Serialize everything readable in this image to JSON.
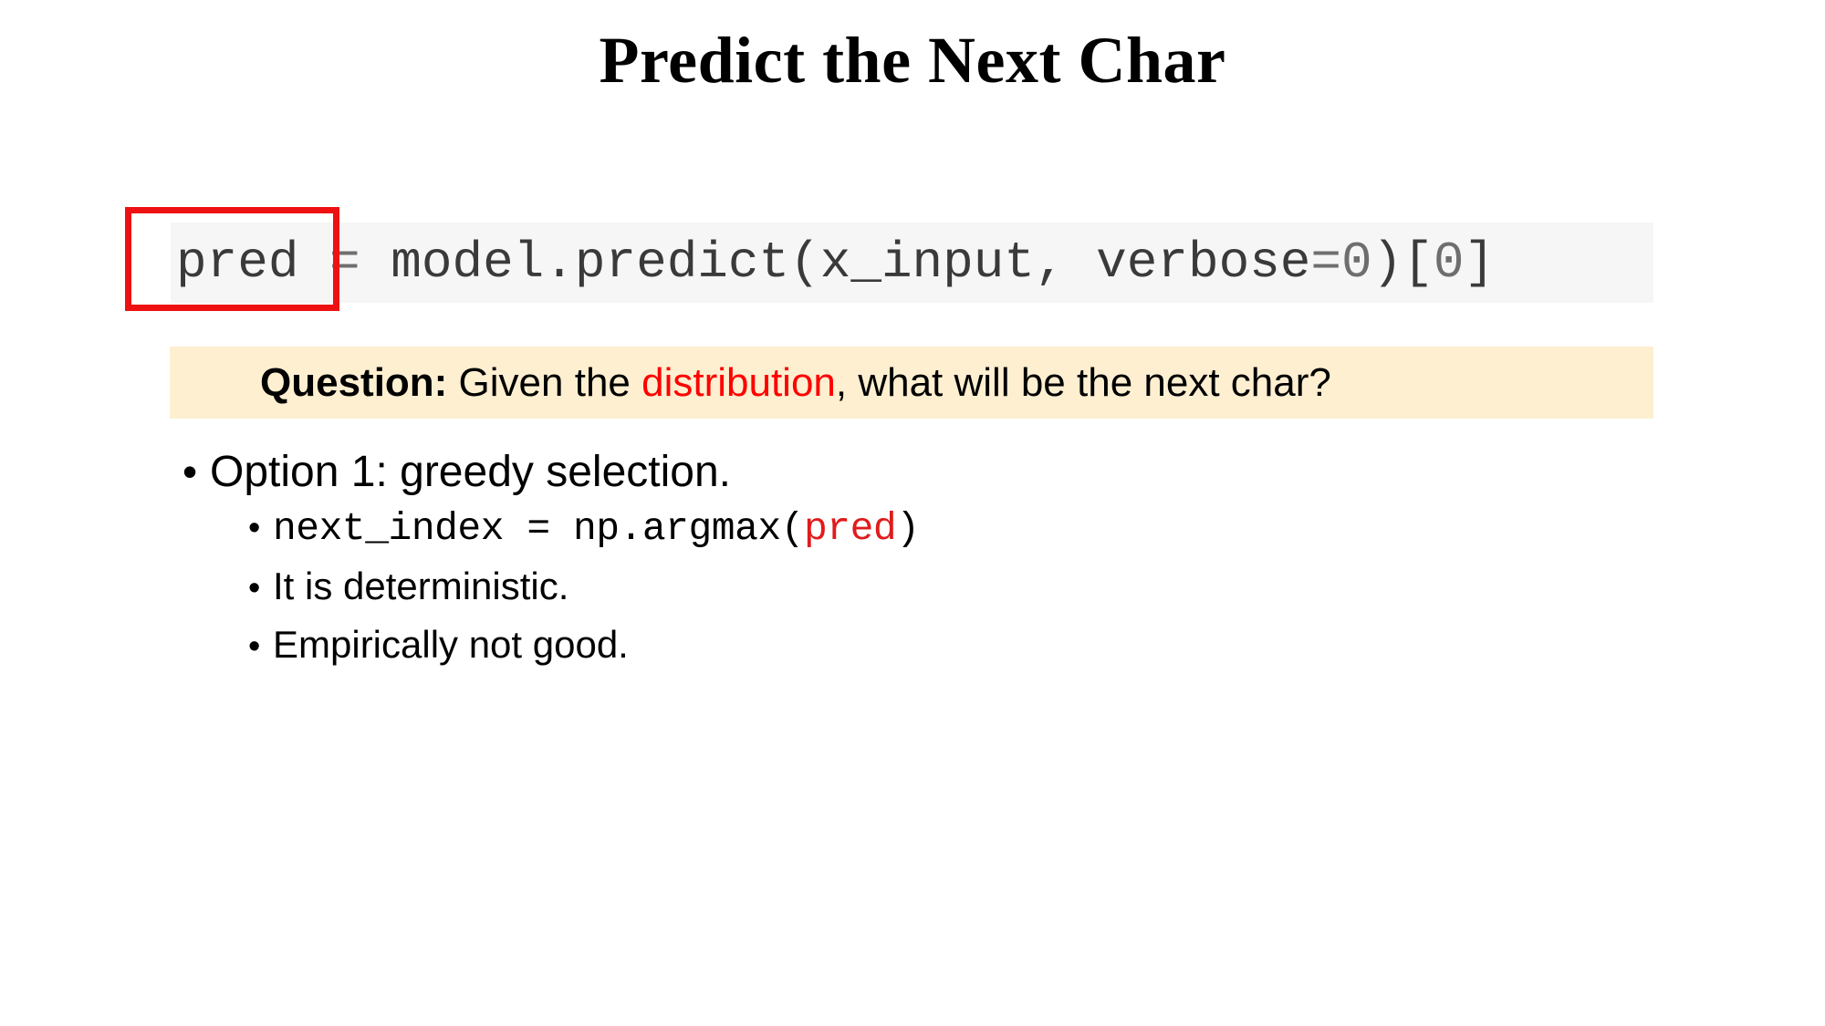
{
  "slide": {
    "title": "Predict the Next Char"
  },
  "code_block": {
    "highlight_label": "pred",
    "segments": {
      "var": "pred",
      "assign": " = ",
      "call": "model.predict(x_input, verbose",
      "eq2": "=",
      "zero1": "0",
      "close": ")[",
      "zero2": "0",
      "bracket": "]"
    },
    "full_text": "pred = model.predict(x_input, verbose=0)[0]"
  },
  "question_banner": {
    "label": "Question:",
    "text_before": " Given the ",
    "accent": "distribution",
    "text_after": ", what will be the next char?"
  },
  "bullets": {
    "bullet_glyph": "•",
    "items": [
      {
        "level": 1,
        "text": "Option 1: greedy selection."
      },
      {
        "level": 2,
        "mono": true,
        "code_prefix": "next_index = np.argmax(",
        "code_accent": "pred",
        "code_suffix": ")"
      },
      {
        "level": 2,
        "text": "It is deterministic."
      },
      {
        "level": 2,
        "text": "Empirically not good."
      }
    ]
  },
  "colors": {
    "accent_red": "#ff0000",
    "highlight_box_red": "#ee1111",
    "banner_bg": "#fdefd0",
    "code_bg": "#f6f6f6",
    "code_fg": "#3a3a3a",
    "code_dim": "#6e6e6e"
  }
}
